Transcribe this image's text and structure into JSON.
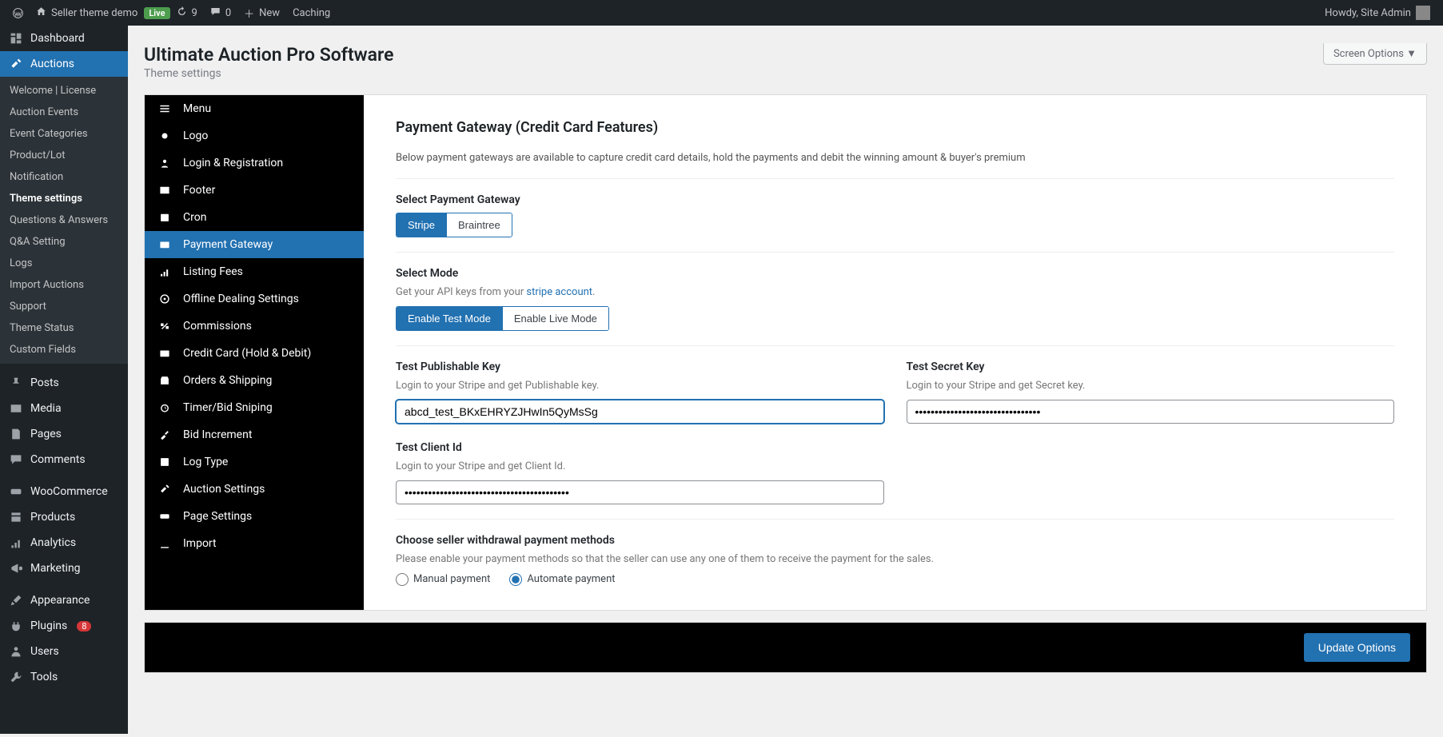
{
  "adminbar": {
    "site": "Seller theme demo",
    "live": "Live",
    "updates": "9",
    "comments": "0",
    "new": "New",
    "caching": "Caching",
    "howdy": "Howdy, Site Admin"
  },
  "sidebar": {
    "main": [
      {
        "label": "Dashboard",
        "icon": "dash"
      },
      {
        "label": "Auctions",
        "icon": "hammer",
        "active": true
      }
    ],
    "auctions_sub": [
      {
        "label": "Welcome | License"
      },
      {
        "label": "Auction Events"
      },
      {
        "label": "Event Categories"
      },
      {
        "label": "Product/Lot"
      },
      {
        "label": "Notification"
      },
      {
        "label": "Theme settings",
        "current": true
      },
      {
        "label": "Questions & Answers"
      },
      {
        "label": "Q&A Setting"
      },
      {
        "label": "Logs"
      },
      {
        "label": "Import Auctions"
      },
      {
        "label": "Support"
      },
      {
        "label": "Theme Status"
      },
      {
        "label": "Custom Fields"
      }
    ],
    "rest": [
      {
        "label": "Posts",
        "icon": "pin"
      },
      {
        "label": "Media",
        "icon": "media"
      },
      {
        "label": "Pages",
        "icon": "page"
      },
      {
        "label": "Comments",
        "icon": "comment"
      },
      {
        "label": "WooCommerce",
        "icon": "woo"
      },
      {
        "label": "Products",
        "icon": "products"
      },
      {
        "label": "Analytics",
        "icon": "analytics"
      },
      {
        "label": "Marketing",
        "icon": "marketing"
      },
      {
        "label": "Appearance",
        "icon": "brush"
      },
      {
        "label": "Plugins",
        "icon": "plugin",
        "badge": "8"
      },
      {
        "label": "Users",
        "icon": "user"
      },
      {
        "label": "Tools",
        "icon": "tool"
      }
    ]
  },
  "page": {
    "title": "Ultimate Auction Pro Software",
    "subtitle": "Theme settings",
    "screen_options": "Screen Options"
  },
  "settings_nav": [
    {
      "label": "Menu",
      "icon": "menu"
    },
    {
      "label": "Logo",
      "icon": "logo"
    },
    {
      "label": "Login & Registration",
      "icon": "login"
    },
    {
      "label": "Footer",
      "icon": "footer"
    },
    {
      "label": "Cron",
      "icon": "cron"
    },
    {
      "label": "Payment Gateway",
      "icon": "card",
      "active": true
    },
    {
      "label": "Listing Fees",
      "icon": "fees"
    },
    {
      "label": "Offline Dealing Settings",
      "icon": "offline"
    },
    {
      "label": "Commissions",
      "icon": "commission"
    },
    {
      "label": "Credit Card (Hold & Debit)",
      "icon": "cc"
    },
    {
      "label": "Orders & Shipping",
      "icon": "orders"
    },
    {
      "label": "Timer/Bid Sniping",
      "icon": "timer"
    },
    {
      "label": "Bid Increment",
      "icon": "bid"
    },
    {
      "label": "Log Type",
      "icon": "log"
    },
    {
      "label": "Auction Settings",
      "icon": "auc"
    },
    {
      "label": "Page Settings",
      "icon": "pset"
    },
    {
      "label": "Import",
      "icon": "import"
    }
  ],
  "content": {
    "heading": "Payment Gateway (Credit Card Features)",
    "intro": "Below payment gateways are available to capture credit card details, hold the payments and debit the winning amount & buyer's premium",
    "select_gateway_label": "Select Payment Gateway",
    "gateway_options": [
      "Stripe",
      "Braintree"
    ],
    "gateway_selected": "Stripe",
    "select_mode_label": "Select Mode",
    "mode_help_prefix": "Get your API keys from your ",
    "mode_help_link": "stripe account",
    "mode_options": [
      "Enable Test Mode",
      "Enable Live Mode"
    ],
    "mode_selected": "Enable Test Mode",
    "pub_key_label": "Test Publishable Key",
    "pub_key_help": "Login to your Stripe and get Publishable key.",
    "pub_key_value": "abcd_test_BKxEHRYZJHwIn5QyMsSg",
    "secret_key_label": "Test Secret Key",
    "secret_key_help": "Login to your Stripe and get Secret key.",
    "secret_key_value": "••••••••••••••••••••••••••••••••",
    "client_id_label": "Test Client Id",
    "client_id_help": "Login to your Stripe and get Client Id.",
    "client_id_value": "••••••••••••••••••••••••••••••••••••••••••",
    "withdrawal_label": "Choose seller withdrawal payment methods",
    "withdrawal_help": "Please enable your payment methods so that the seller can use any one of them to receive the payment for the sales.",
    "withdrawal_manual": "Manual payment",
    "withdrawal_auto": "Automate payment",
    "update_button": "Update Options"
  }
}
